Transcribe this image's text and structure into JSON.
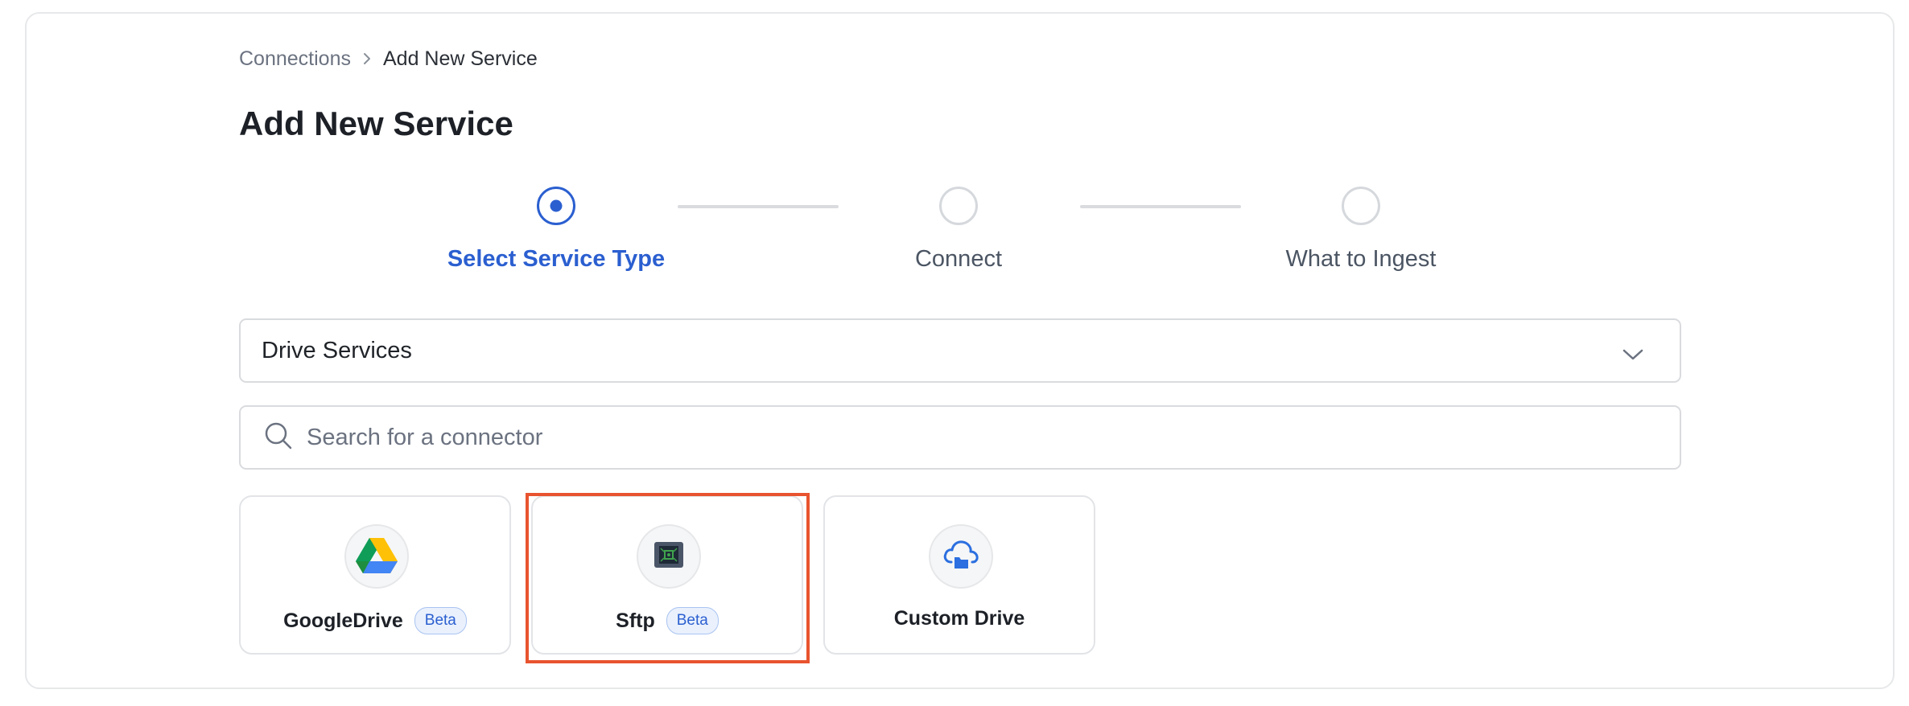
{
  "breadcrumb": {
    "parent": "Connections",
    "current": "Add New Service"
  },
  "page": {
    "title": "Add New Service"
  },
  "steps": [
    {
      "label": "Select Service Type",
      "state": "active"
    },
    {
      "label": "Connect",
      "state": "pending"
    },
    {
      "label": "What to Ingest",
      "state": "pending"
    }
  ],
  "service_category": {
    "selected": "Drive Services"
  },
  "search": {
    "placeholder": "Search for a connector",
    "value": ""
  },
  "connectors": [
    {
      "name": "GoogleDrive",
      "badge": "Beta",
      "icon": "google-drive-icon"
    },
    {
      "name": "Sftp",
      "badge": "Beta",
      "icon": "sftp-server-icon"
    },
    {
      "name": "Custom Drive",
      "badge": "",
      "icon": "cloud-folder-icon"
    }
  ],
  "colors": {
    "accent": "#2b5fd0",
    "highlight": "#e8542f",
    "border": "#d9dbde"
  }
}
